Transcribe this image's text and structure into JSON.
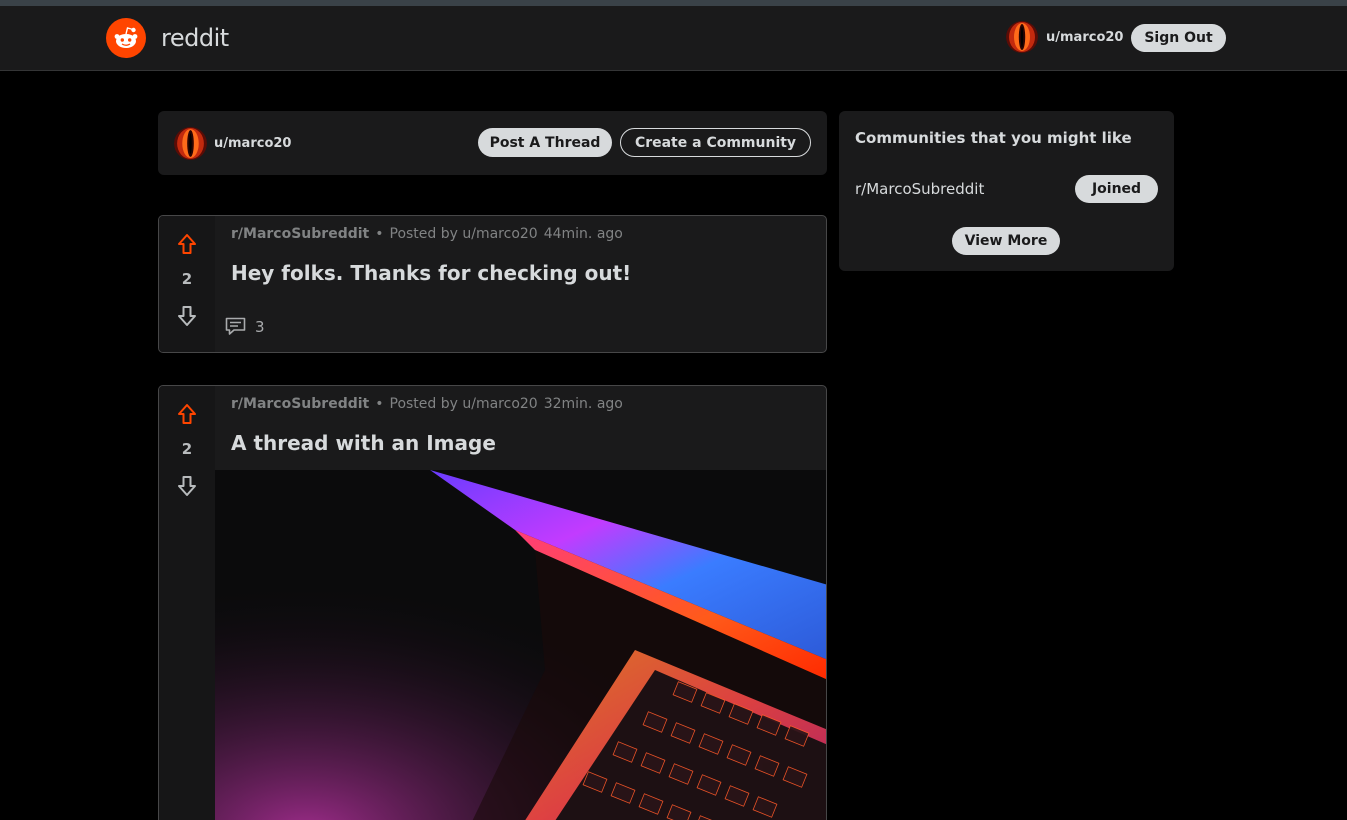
{
  "header": {
    "logo_text": "reddit",
    "username": "u/marco20",
    "sign_out_label": "Sign Out",
    "brand_color": "#ff4500"
  },
  "action_bar": {
    "username": "u/marco20",
    "post_thread_label": "Post A Thread",
    "create_community_label": "Create a Community"
  },
  "posts": [
    {
      "subreddit": "r/MarcoSubreddit",
      "dot": "•",
      "posted_by": "Posted by u/marco20",
      "time": "44min. ago",
      "title": "Hey folks. Thanks for checking out!",
      "votes": "2",
      "comment_count": "3"
    },
    {
      "subreddit": "r/MarcoSubreddit",
      "dot": "•",
      "posted_by": "Posted by u/marco20",
      "time": "32min. ago",
      "title": "A thread with an Image",
      "votes": "2"
    }
  ],
  "sidebar": {
    "title": "Communities that you might like",
    "communities": [
      {
        "name": "r/MarcoSubreddit",
        "button_label": "Joined"
      }
    ],
    "view_more_label": "View More"
  },
  "icons": {
    "upvote": "upvote-arrow-icon",
    "downvote": "downvote-arrow-icon",
    "comment": "comment-icon",
    "logo": "reddit-alien-icon",
    "avatar": "user-avatar"
  },
  "colors": {
    "upvote_active": "#ff4500",
    "background": "#000000",
    "card": "#1a1a1b"
  }
}
